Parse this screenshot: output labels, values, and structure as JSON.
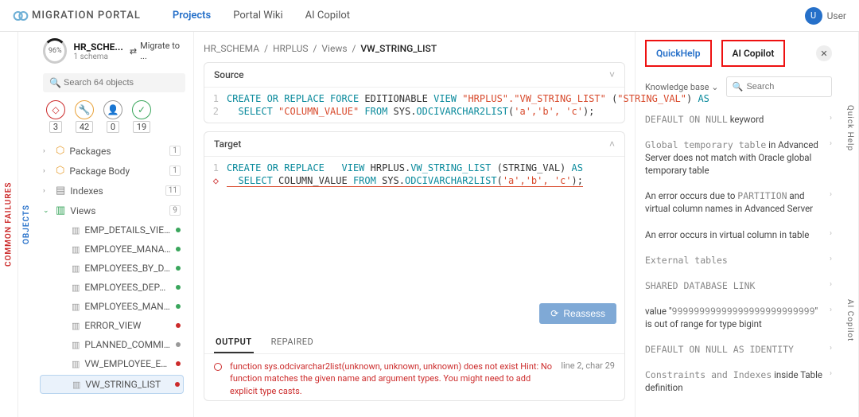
{
  "brand": "MIGRATION PORTAL",
  "nav": {
    "projects": "Projects",
    "wiki": "Portal Wiki",
    "copilot": "AI Copilot"
  },
  "user": {
    "initial": "U",
    "name": "User"
  },
  "vtabs": {
    "objects": "OBJECTS",
    "failures": "COMMON FAILURES",
    "quickhelp": "Quick Help",
    "aicopilot": "AI Copilot"
  },
  "sidebar": {
    "progress": "96%",
    "schema_name": "HR_SCHE...",
    "schema_sub": "1 schema",
    "migrate_label": "Migrate to ...",
    "search_placeholder": "Search 64 objects",
    "status": {
      "red": "3",
      "orange": "42",
      "gray": "0",
      "green": "19"
    },
    "groups": [
      {
        "label": "Packages",
        "count": "1"
      },
      {
        "label": "Package Body",
        "count": "1"
      },
      {
        "label": "Indexes",
        "count": "11"
      },
      {
        "label": "Views",
        "count": "9"
      }
    ],
    "views": [
      {
        "label": "EMP_DETAILS_VIEW",
        "status": "green"
      },
      {
        "label": "EMPLOYEE_MANA...",
        "status": "green"
      },
      {
        "label": "EMPLOYEES_BY_D...",
        "status": "green"
      },
      {
        "label": "EMPLOYEES_DEPA...",
        "status": "green"
      },
      {
        "label": "EMPLOYEES_MAN...",
        "status": "green"
      },
      {
        "label": "ERROR_VIEW",
        "status": "red"
      },
      {
        "label": "PLANNED_COMMI...",
        "status": "gray"
      },
      {
        "label": "VW_EMPLOYEE_EX...",
        "status": "red"
      },
      {
        "label": "VW_STRING_LIST",
        "status": "red"
      }
    ]
  },
  "breadcrumb": {
    "a": "HR_SCHEMA",
    "b": "HRPLUS",
    "c": "Views",
    "d": "VW_STRING_LIST"
  },
  "source": {
    "title": "Source",
    "line1_a": "CREATE OR REPLACE FORCE",
    "line1_b": " EDITIONABLE ",
    "line1_c": "VIEW",
    "line1_d": " \"HRPLUS\".\"VW_STRING_LIST\"",
    "line1_e": " (",
    "line1_f": "\"STRING_VAL\"",
    "line1_g": ") ",
    "line1_h": "AS",
    "line2_a": "  SELECT",
    "line2_b": " \"COLUMN_VALUE\" ",
    "line2_c": "FROM",
    "line2_d": " SYS.",
    "line2_e": "ODCIVARCHAR2LIST",
    "line2_f": "(",
    "line2_g": "'a','b', 'c'",
    "line2_h": ");"
  },
  "target": {
    "title": "Target",
    "line1_a": "CREATE OR REPLACE   ",
    "line1_b": "VIEW",
    "line1_c": " HRPLUS.",
    "line1_d": "VW_STRING_LIST",
    "line1_e": " (STRING_VAL) ",
    "line1_f": "AS",
    "line2_a": "  SELECT",
    "line2_b": " COLUMN_VALUE ",
    "line2_c": "FROM",
    "line2_d": " SYS.",
    "line2_e": "ODCIVARCHAR2LIST",
    "line2_f": "(",
    "line2_g": "'a','b', 'c'",
    "line2_h": ");",
    "reassess": "Reassess"
  },
  "out_tabs": {
    "output": "OUTPUT",
    "repaired": "REPAIRED"
  },
  "error": {
    "msg": "function sys.odcivarchar2list(unknown, unknown, unknown) does not exist Hint: No function matches the given name and argument types. You might need to add explicit type casts.",
    "loc": "line 2, char 29"
  },
  "rpanel": {
    "quickhelp": "QuickHelp",
    "aicopilot": "AI Copilot",
    "kb_label": "Knowledge base",
    "search_placeholder": "Search",
    "items": [
      {
        "mono": "DEFAULT ON NULL",
        "rest": " keyword"
      },
      {
        "mono": "Global temporary table",
        "rest": " in Advanced Server does not match with Oracle global temporary table"
      },
      {
        "pre": "An error occurs due to ",
        "mono": "PARTITION",
        "rest": " and virtual column names in Advanced Server"
      },
      {
        "rest": "An error occurs in virtual column in table"
      },
      {
        "mono": "External tables"
      },
      {
        "mono": "SHARED DATABASE LINK"
      },
      {
        "pre": "value \"",
        "mono": "99999999999999999999999999",
        "rest": "\" is out of range for type bigint"
      },
      {
        "mono": "DEFAULT ON NULL AS IDENTITY"
      },
      {
        "mono": "Constraints and Indexes",
        "rest": " inside Table definition"
      }
    ]
  }
}
